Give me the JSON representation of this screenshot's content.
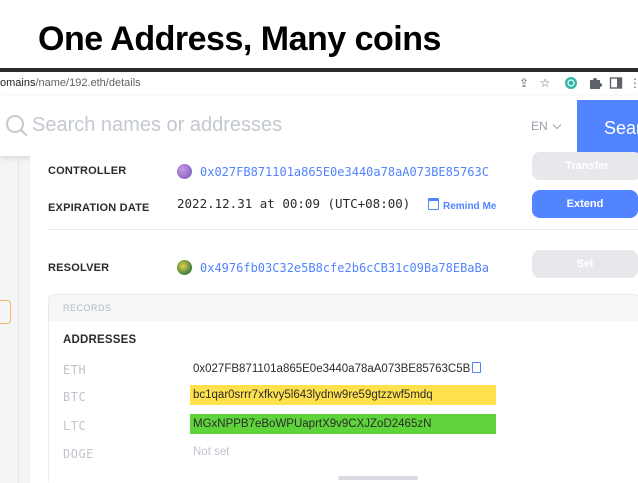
{
  "slide": {
    "title": "One Address, Many coins"
  },
  "browser": {
    "url_prefix": "omains",
    "url_rest": "/name/192.eth/details",
    "icons": [
      "share-icon",
      "star-icon",
      "extension-globe-icon",
      "puzzle-icon",
      "sidebar-icon",
      "menu-icon"
    ]
  },
  "header": {
    "search_placeholder": "Search names or addresses",
    "lang": "EN",
    "search_button": "Search"
  },
  "details": {
    "controller_label": "CONTROLLER",
    "controller_address": "0x027FB871101a865E0e3440a78aA073BE85763C",
    "transfer_button": "Transfer",
    "expiration_label": "EXPIRATION DATE",
    "expiration_value": "2022.12.31 at 00:09 (UTC+08:00)",
    "remind_me": "Remind Me",
    "extend_button": "Extend",
    "resolver_label": "RESOLVER",
    "resolver_address": "0x4976fb03C32e5B8cfe2b6cCB31c09Ba78EBaBa",
    "set_button": "Set"
  },
  "records": {
    "section_label": "RECORDS",
    "addresses_label": "ADDRESSES",
    "rows": [
      {
        "coin": "ETH",
        "value": "0x027FB871101a865E0e3440a78aA073BE85763C5B"
      },
      {
        "coin": "BTC",
        "value": "bc1qar0srrr7xfkvy5l643lydnw9re59gtzzwf5mdq"
      },
      {
        "coin": "LTC",
        "value": "MGxNPPB7eBoWPUaprtX9v9CXJZoD2465zN"
      },
      {
        "coin": "DOGE",
        "value": "Not set"
      }
    ]
  },
  "colors": {
    "accent": "#5284ff",
    "btc_highlight": "#ffe14d",
    "ltc_highlight": "#5fd43a"
  }
}
